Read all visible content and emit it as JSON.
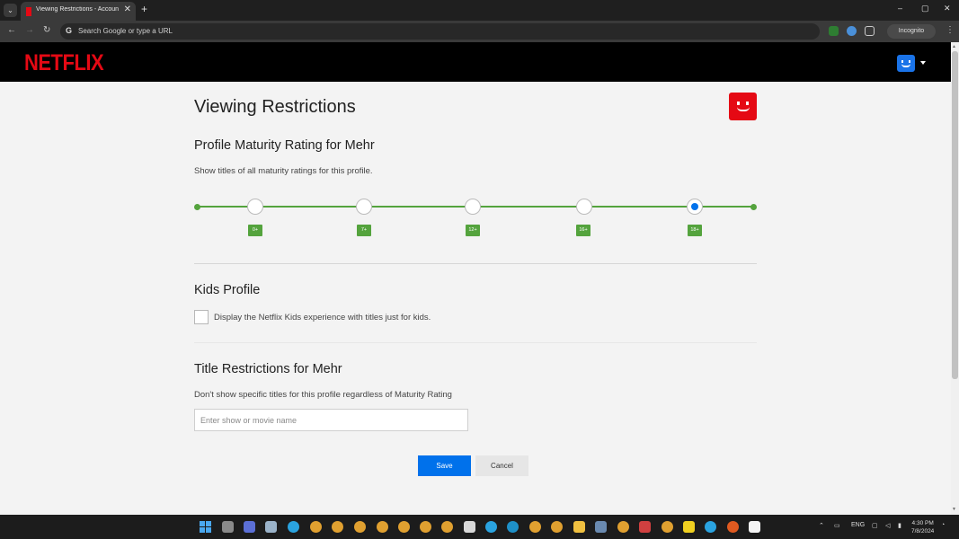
{
  "browser": {
    "tab_title": "Viewing Restrictions - Account",
    "tab_close": "✕",
    "new_tab": "+",
    "omnibox_placeholder": "Search Google or type a URL",
    "incognito_label": "Incognito",
    "window_controls": [
      "–",
      "▢",
      "✕"
    ]
  },
  "header": {
    "logo": "NETFLIX"
  },
  "page": {
    "title": "Viewing Restrictions",
    "maturity": {
      "title": "Profile Maturity Rating for Mehr",
      "description": "Show titles of all maturity ratings for this profile.",
      "ratings": [
        "0+",
        "7+",
        "12+",
        "16+",
        "18+"
      ],
      "selected": "18+"
    },
    "kids": {
      "title": "Kids Profile",
      "checkbox_label": "Display the Netflix Kids experience with titles just for kids.",
      "checked": false
    },
    "title_restrictions": {
      "title": "Title Restrictions for Mehr",
      "description": "Don't show specific titles for this profile regardless of Maturity Rating",
      "input_placeholder": "Enter show or movie name",
      "input_value": ""
    },
    "buttons": {
      "save": "Save",
      "cancel": "Cancel"
    }
  },
  "taskbar": {
    "language": "ENG",
    "time": "4:30 PM",
    "date": "7/8/2024"
  },
  "colors": {
    "netflix_red": "#e50914",
    "slider_green": "#54a33d",
    "save_blue": "#0071eb"
  }
}
